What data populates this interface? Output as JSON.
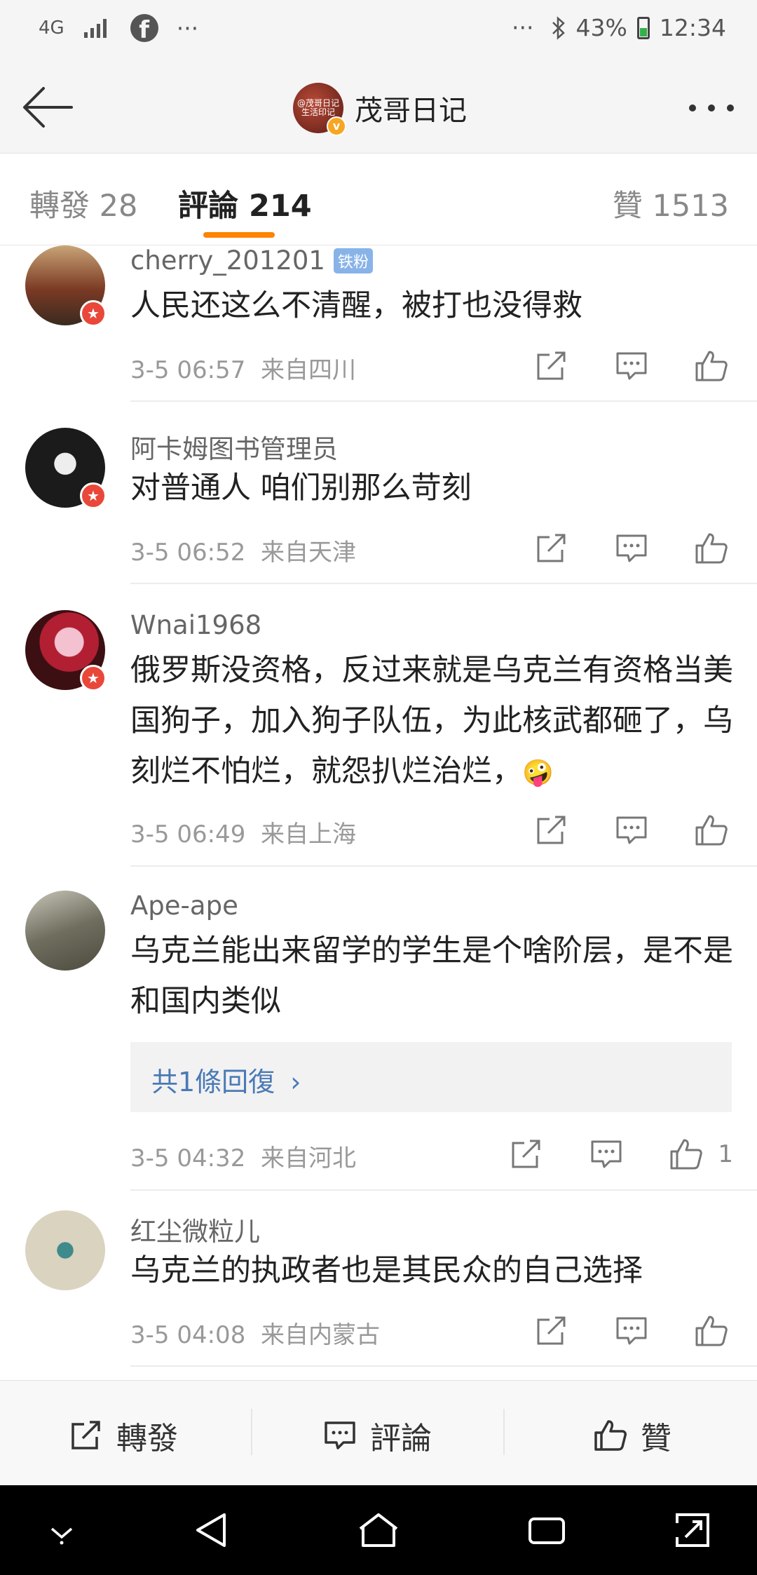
{
  "status_bar": {
    "network": "4G",
    "facebook_glyph": "f",
    "more_left": "···",
    "more_right": "···",
    "battery": "43%",
    "time": "12:34"
  },
  "nav": {
    "title": "茂哥日记",
    "avatar_text": "@茂哥日记 生活印记",
    "verified": "v"
  },
  "tabs": {
    "repost": "轉發 28",
    "comment": "評論 214",
    "like": "贊 1513"
  },
  "comments": [
    {
      "user": "cherry_201201",
      "badge": "铁粉",
      "text": "人民还这么不清醒，被打也没得救",
      "time": "3-5 06:57",
      "location": "来自四川",
      "avatar_bg": "#8a5a3a"
    },
    {
      "user": "阿卡姆图书管理员",
      "text": "对普通人 咱们别那么苛刻",
      "time": "3-5 06:52",
      "location": "来自天津",
      "avatar_bg": "#1c1c1c"
    },
    {
      "user": "Wnai1968",
      "text": "俄罗斯没资格，反过来就是乌克兰有资格当美国狗子，加入狗子队伍，为此核武都砸了，乌刻烂不怕烂，就怨扒烂治烂，",
      "emoji": "🤪",
      "time": "3-5 06:49",
      "location": "来自上海",
      "avatar_bg": "#7a1a22"
    },
    {
      "user": "Ape-ape",
      "text": "乌克兰能出来留学的学生是个啥阶层，是不是和国内类似",
      "reply_text": "共1條回復",
      "time": "3-5 04:32",
      "location": "来自河北",
      "like_count": "1",
      "avatar_bg": "#8c8c7a"
    },
    {
      "user": "红尘微粒儿",
      "text": "乌克兰的执政者也是其民众的自己选择",
      "time": "3-5 04:08",
      "location": "来自内蒙古",
      "avatar_bg": "#b7b29a"
    }
  ],
  "bottom_bar": {
    "repost": "轉發",
    "comment": "評論",
    "like": "贊"
  },
  "colors": {
    "accent": "#ff8200",
    "link": "#4a7ab5",
    "vip_red": "#e9473a"
  }
}
